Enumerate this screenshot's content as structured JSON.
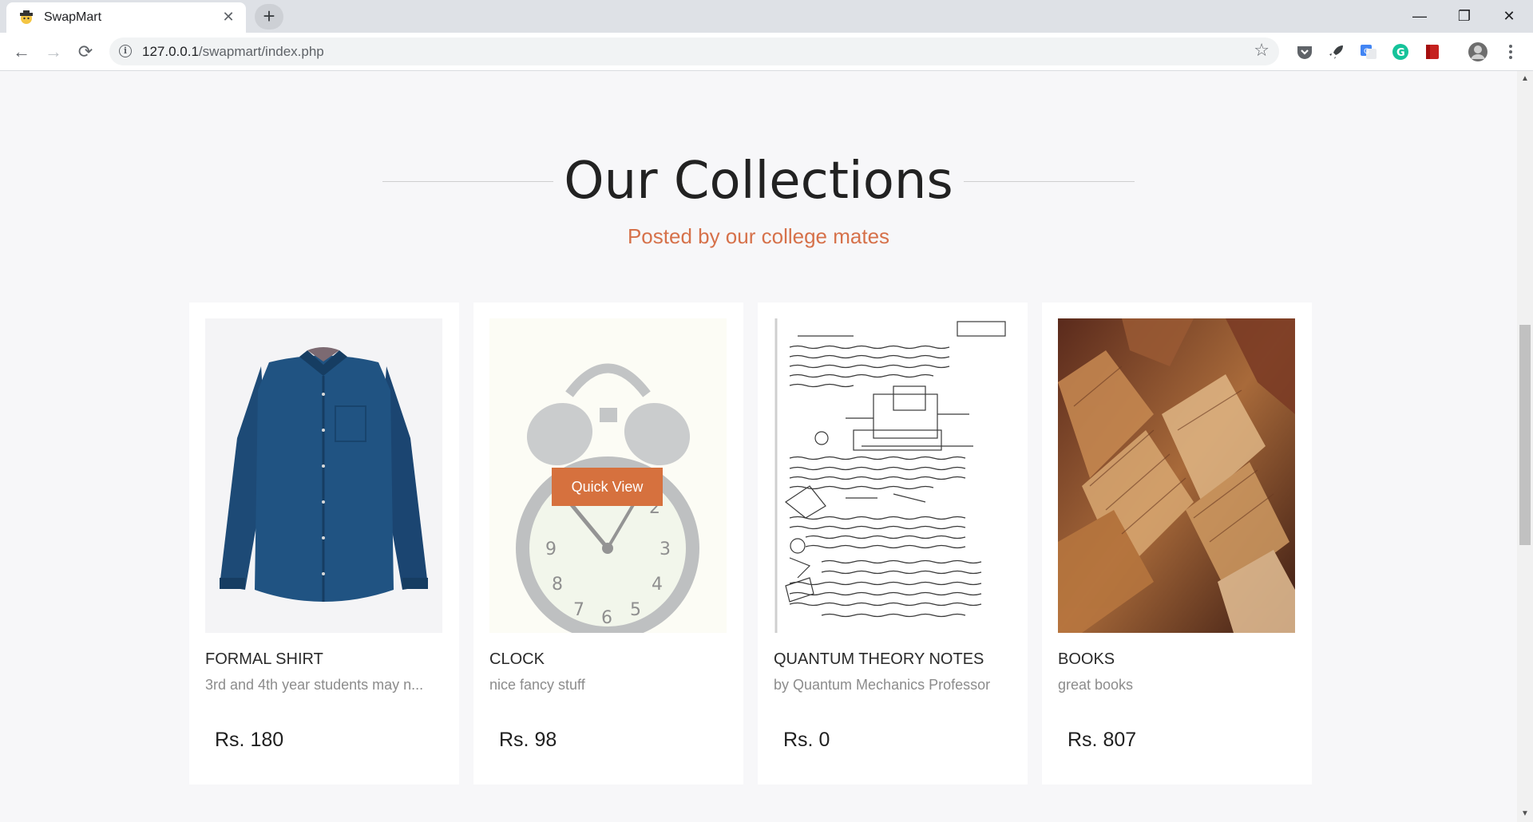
{
  "browser": {
    "tab_title": "SwapMart",
    "url_host": "127.0.0.1",
    "url_path": "/swapmart/index.php",
    "new_tab_label": "+",
    "back_label": "←",
    "forward_label": "→",
    "reload_label": "⟳",
    "minimize_label": "—",
    "restore_label": "❐",
    "close_label": "✕",
    "tab_close_label": "✕",
    "star_label": "☆"
  },
  "section": {
    "title": "Our Collections",
    "subtitle": "Posted by our college mates"
  },
  "products": [
    {
      "name": "FORMAL SHIRT",
      "description": "3rd and 4th year students may n...",
      "price": "Rs. 180",
      "image": "shirt"
    },
    {
      "name": "CLOCK",
      "description": "nice fancy stuff",
      "price": "Rs. 98",
      "image": "alarm-clock",
      "hover_button": "Quick View"
    },
    {
      "name": "QUANTUM THEORY NOTES",
      "description": "by Quantum Mechanics Professor",
      "price": "Rs. 0",
      "image": "handwritten-notes"
    },
    {
      "name": "BOOKS",
      "description": "great books",
      "price": "Rs. 807",
      "image": "books-stack"
    }
  ],
  "colors": {
    "accent": "#d6714a",
    "page_background": "#f7f7f9",
    "card_background": "#ffffff"
  }
}
